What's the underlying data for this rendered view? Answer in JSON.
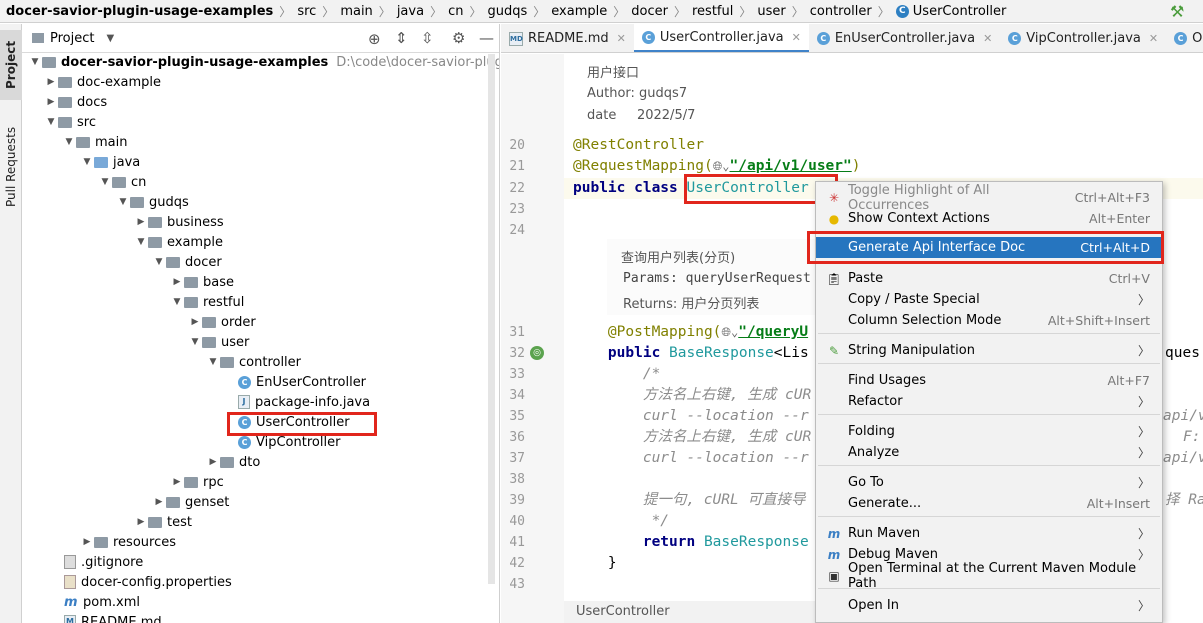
{
  "breadcrumb": [
    "docer-savior-plugin-usage-examples",
    "src",
    "main",
    "java",
    "cn",
    "gudqs",
    "example",
    "docer",
    "restful",
    "user",
    "controller",
    "UserController"
  ],
  "left_strip": {
    "project": "Project",
    "pull_requests": "Pull Requests"
  },
  "project_panel": {
    "title": "Project",
    "root_name": "docer-savior-plugin-usage-examples",
    "root_path": "D:\\code\\docer-savior-plugin-usage",
    "tree": [
      "doc-example",
      "docs",
      "src",
      "main",
      "java",
      "cn",
      "gudqs",
      "business",
      "example",
      "docer",
      "base",
      "restful",
      "order",
      "user",
      "controller",
      "EnUserController",
      "package-info.java",
      "UserController",
      "VipController",
      "dto",
      "rpc",
      "genset",
      "test",
      "resources",
      ".gitignore",
      "docer-config.properties",
      "pom.xml",
      "README.md"
    ]
  },
  "tabs": [
    "README.md",
    "UserController.java",
    "EnUserController.java",
    "VipController.java",
    "OrderCont"
  ],
  "editor": {
    "doc_top": {
      "desc": "用户接口",
      "author": "Author: gudqs7",
      "date": "date     2022/5/7"
    },
    "doc_method": {
      "desc": "查询用户列表(分页)",
      "params": "Params: queryUserRequest -",
      "returns": "Returns: 用户分页列表"
    },
    "lines": [
      "20",
      "21",
      "22",
      "23",
      "24",
      "31",
      "32",
      "33",
      "34",
      "35",
      "36",
      "37",
      "38",
      "39",
      "40",
      "41",
      "42",
      "43"
    ],
    "code": {
      "l20": "@RestController",
      "l21a": "@RequestMapping(",
      "l21b": "\"/api/v1/user\"",
      "l21c": ")",
      "l22a": "public class ",
      "l22b": "UserController",
      "l31a": "    @PostMapping(",
      "l31b": "\"/queryU",
      "l32a": "    public ",
      "l32b": "BaseResponse",
      "l32c": "<Lis",
      "l32tail": "ques",
      "l33": "        /*",
      "l34": "        方法名上右键, 生成 cUR",
      "l35": "        curl --location --r",
      "l35tail": "api/v",
      "l36": "        方法名上右键, 生成 cUR",
      "l36tail": "F:",
      "l37": "        curl --location --r",
      "l37tail": "api/v",
      "l39": "        提一句, cURL 可直接导",
      "l39tail": "择 Raw",
      "l40": "         */",
      "l41a": "        return ",
      "l41b": "BaseResponse",
      "l42": "    }"
    },
    "status": "UserController"
  },
  "menu": {
    "items": [
      {
        "label": "Toggle Highlight of All Occurrences",
        "shortcut": "Ctrl+Alt+F3"
      },
      {
        "label": "Show Context Actions",
        "shortcut": "Alt+Enter"
      },
      {
        "label": "Generate Api Interface Doc",
        "shortcut": "Ctrl+Alt+D"
      },
      {
        "label": "Paste",
        "shortcut": "Ctrl+V"
      },
      {
        "label": "Copy / Paste Special",
        "shortcut": ""
      },
      {
        "label": "Column Selection Mode",
        "shortcut": "Alt+Shift+Insert"
      },
      {
        "label": "String Manipulation",
        "shortcut": ""
      },
      {
        "label": "Find Usages",
        "shortcut": "Alt+F7"
      },
      {
        "label": "Refactor",
        "shortcut": ""
      },
      {
        "label": "Folding",
        "shortcut": ""
      },
      {
        "label": "Analyze",
        "shortcut": ""
      },
      {
        "label": "Go To",
        "shortcut": ""
      },
      {
        "label": "Generate...",
        "shortcut": "Alt+Insert"
      },
      {
        "label": "Run Maven",
        "shortcut": ""
      },
      {
        "label": "Debug Maven",
        "shortcut": ""
      },
      {
        "label": "Open Terminal at the Current Maven Module Path",
        "shortcut": ""
      },
      {
        "label": "Open In",
        "shortcut": ""
      }
    ]
  },
  "colors": {
    "accent": "#2675bf",
    "highlight_box": "#e1261c"
  }
}
